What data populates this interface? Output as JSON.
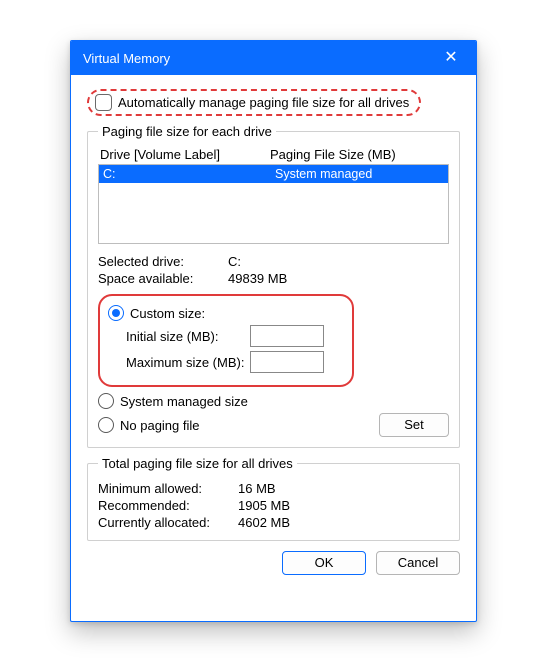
{
  "title": "Virtual Memory",
  "auto_manage_label": "Automatically manage paging file size for all drives",
  "group_each": {
    "legend": "Paging file size for each drive",
    "header_drive": "Drive  [Volume Label]",
    "header_size": "Paging File Size (MB)",
    "rows": [
      {
        "drive": "C:",
        "size": "System managed"
      }
    ],
    "selected_drive_label": "Selected drive:",
    "selected_drive_value": "C:",
    "space_label": "Space available:",
    "space_value": "49839 MB",
    "custom_label": "Custom size:",
    "initial_label": "Initial size (MB):",
    "initial_value": "",
    "max_label": "Maximum size (MB):",
    "max_value": "",
    "system_managed_label": "System managed size",
    "no_paging_label": "No paging file",
    "set_label": "Set"
  },
  "group_total": {
    "legend": "Total paging file size for all drives",
    "min_label": "Minimum allowed:",
    "min_value": "16 MB",
    "rec_label": "Recommended:",
    "rec_value": "1905 MB",
    "cur_label": "Currently allocated:",
    "cur_value": "4602 MB"
  },
  "buttons": {
    "ok": "OK",
    "cancel": "Cancel"
  }
}
